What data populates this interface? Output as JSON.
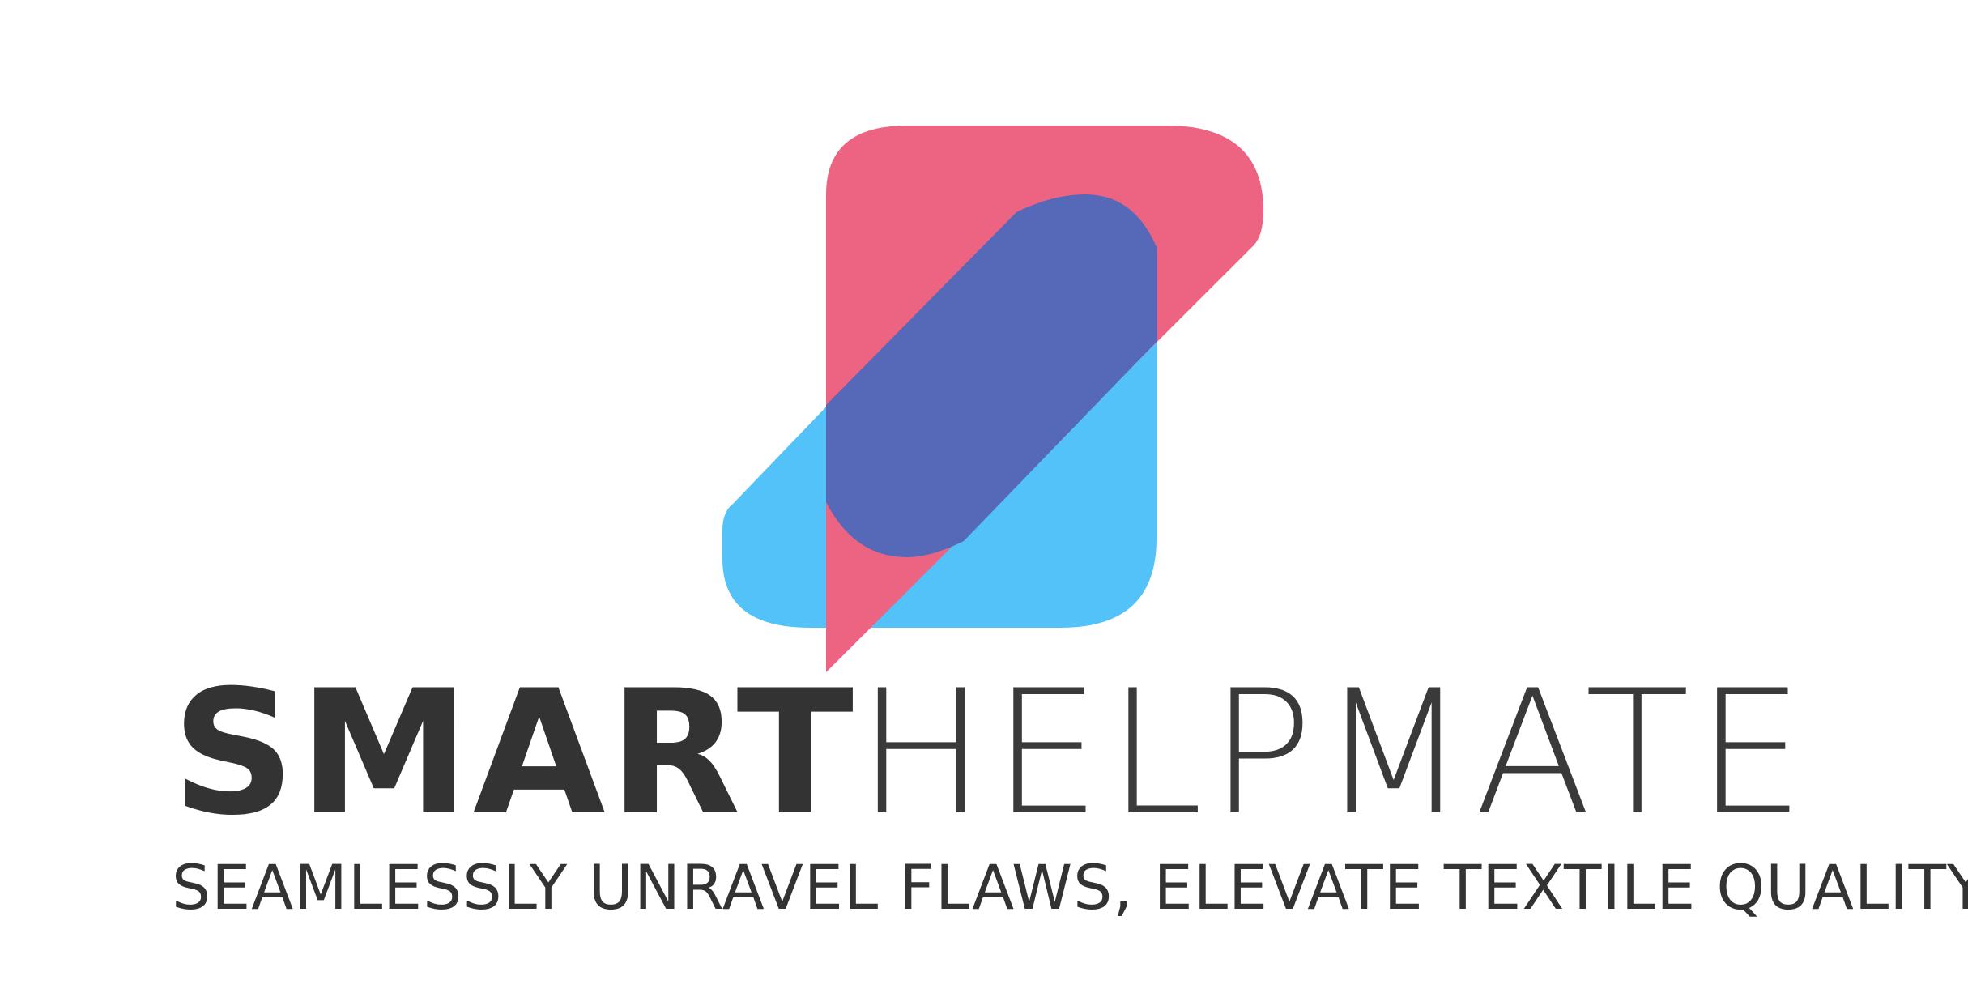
{
  "brand": {
    "name_bold": "SMART",
    "name_light": "HELPMATE",
    "tagline": "SEAMLESSLY UNRAVEL FLAWS, ELEVATE TEXTILE QUALITY"
  },
  "colors": {
    "pink": "#ec6482",
    "blue": "#52c2f8",
    "overlap": "#5569b8",
    "text": "#333333",
    "background": "#ffffff"
  },
  "icons": [
    "logo-mark-icon"
  ]
}
